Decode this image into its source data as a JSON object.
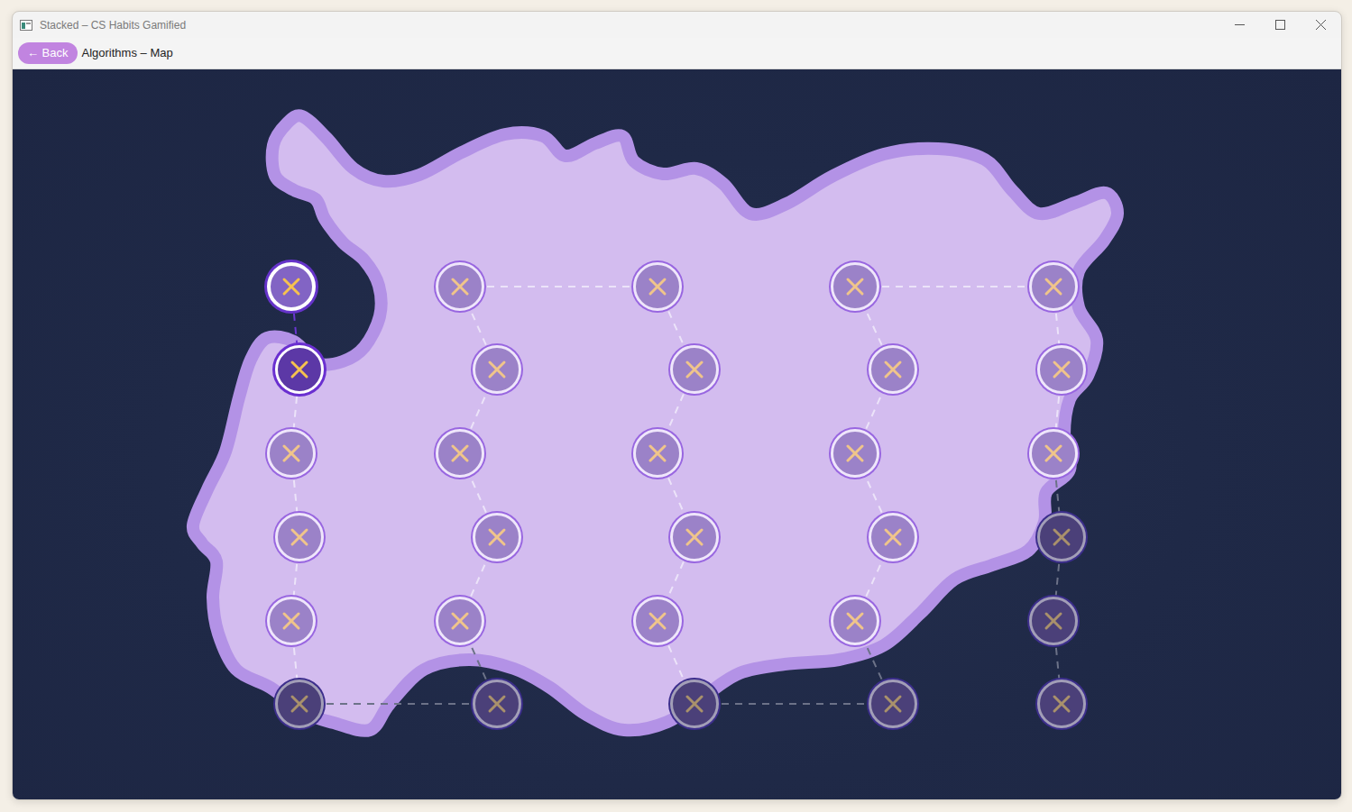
{
  "window": {
    "title": "Stacked – CS Habits Gamified"
  },
  "toolbar": {
    "back_label": "← Back",
    "title": "Algorithms – Map"
  },
  "map": {
    "nodes": [
      {
        "state": "current"
      },
      {
        "state": "unlocked"
      },
      {
        "state": "available"
      },
      {
        "state": "available"
      },
      {
        "state": "available"
      },
      {
        "state": "locked"
      },
      {
        "state": "locked"
      },
      {
        "state": "available"
      },
      {
        "state": "available"
      },
      {
        "state": "available"
      },
      {
        "state": "available"
      },
      {
        "state": "available"
      },
      {
        "state": "available"
      },
      {
        "state": "available"
      },
      {
        "state": "available"
      },
      {
        "state": "available"
      },
      {
        "state": "available"
      },
      {
        "state": "locked"
      },
      {
        "state": "locked"
      },
      {
        "state": "available"
      },
      {
        "state": "available"
      },
      {
        "state": "available"
      },
      {
        "state": "available"
      },
      {
        "state": "available"
      },
      {
        "state": "available"
      },
      {
        "state": "available"
      },
      {
        "state": "available"
      },
      {
        "state": "locked"
      },
      {
        "state": "locked"
      },
      {
        "state": "locked"
      }
    ],
    "edges": [
      {
        "state": "done"
      },
      {
        "state": "open"
      },
      {
        "state": "open"
      },
      {
        "state": "open"
      },
      {
        "state": "open"
      },
      {
        "state": "locked"
      },
      {
        "state": "locked"
      },
      {
        "state": "open"
      },
      {
        "state": "open"
      },
      {
        "state": "open"
      },
      {
        "state": "open"
      },
      {
        "state": "open"
      },
      {
        "state": "open"
      },
      {
        "state": "open"
      },
      {
        "state": "open"
      },
      {
        "state": "open"
      },
      {
        "state": "open"
      },
      {
        "state": "locked"
      },
      {
        "state": "locked"
      },
      {
        "state": "open"
      },
      {
        "state": "open"
      },
      {
        "state": "open"
      },
      {
        "state": "open"
      },
      {
        "state": "open"
      },
      {
        "state": "open"
      },
      {
        "state": "open"
      },
      {
        "state": "locked"
      },
      {
        "state": "locked"
      },
      {
        "state": "locked"
      }
    ]
  }
}
